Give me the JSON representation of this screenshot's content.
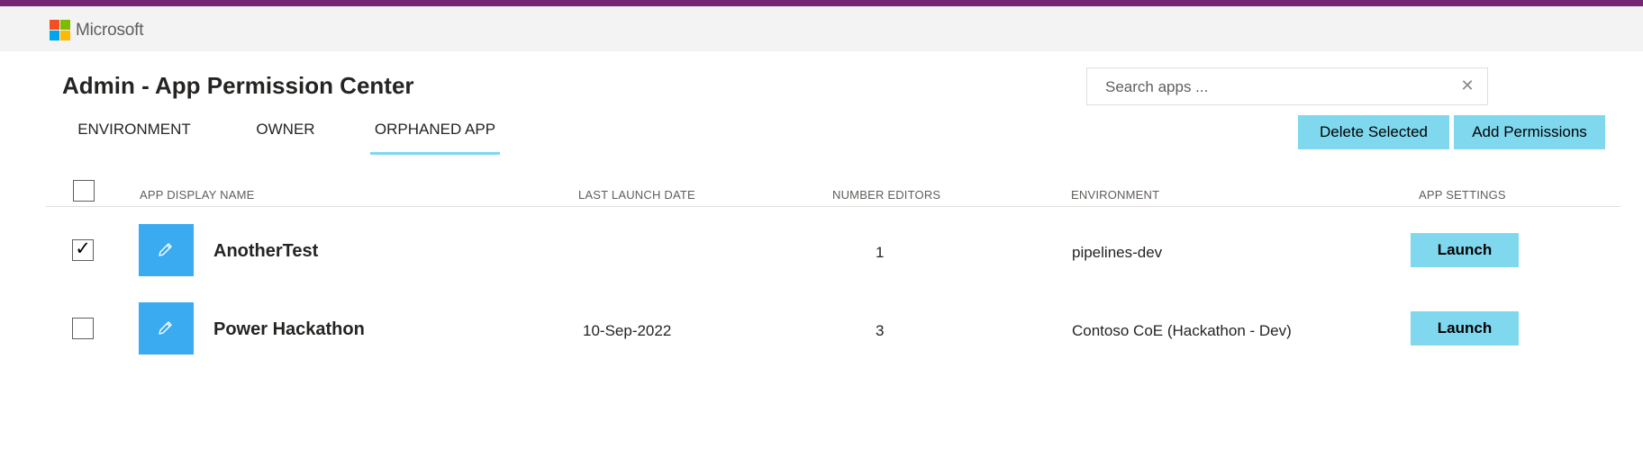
{
  "brand": {
    "name": "Microsoft",
    "logo_colors": [
      "#f25022",
      "#7fba00",
      "#00a4ef",
      "#ffb900"
    ],
    "accent_bar_color": "#742774"
  },
  "page": {
    "title": "Admin - App Permission Center"
  },
  "tabs": [
    {
      "label": "ENVIRONMENT",
      "active": false
    },
    {
      "label": "OWNER",
      "active": false
    },
    {
      "label": "ORPHANED APP",
      "active": true
    }
  ],
  "search": {
    "placeholder": "Search apps ...",
    "value": "",
    "clear_icon": "close-icon"
  },
  "actions": {
    "delete_label": "Delete Selected",
    "add_label": "Add Permissions",
    "button_color": "#7fd8ee"
  },
  "table": {
    "select_all_checked": false,
    "columns": [
      "APP DISPLAY NAME",
      "LAST LAUNCH DATE",
      "NUMBER EDITORS",
      "ENVIRONMENT",
      "APP SETTINGS"
    ],
    "rows": [
      {
        "checked": true,
        "icon": "pencil-icon",
        "name": "AnotherTest",
        "last_launch": "",
        "editors": "1",
        "environment": "pipelines-dev",
        "launch_label": "Launch"
      },
      {
        "checked": false,
        "icon": "pencil-icon",
        "name": "Power Hackathon",
        "last_launch": "10-Sep-2022",
        "editors": "3",
        "environment": "Contoso CoE (Hackathon - Dev)",
        "launch_label": "Launch"
      }
    ]
  }
}
